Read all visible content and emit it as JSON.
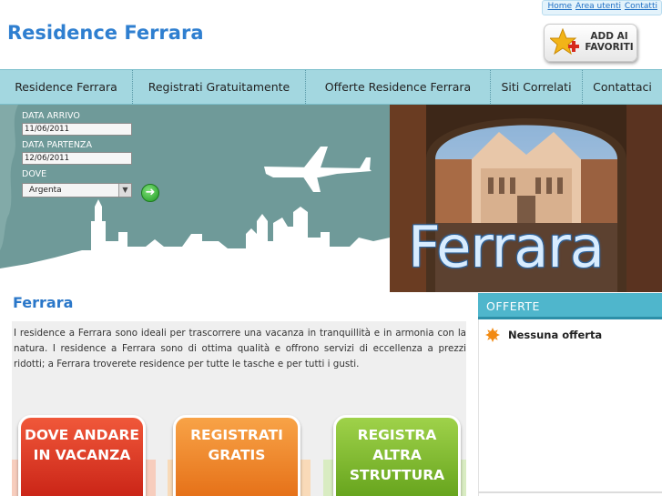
{
  "header": {
    "site_title": "Residence Ferrara",
    "top_links": [
      "Home",
      "Area utenti",
      "Contatti"
    ],
    "favorites_button": "ADD AI FAVORITI"
  },
  "nav": {
    "items": [
      "Residence Ferrara",
      "Registrati Gratuitamente",
      "Offerte Residence Ferrara",
      "Siti Correlati",
      "Contattaci"
    ]
  },
  "search_form": {
    "arrival_label": "DATA ARRIVO",
    "arrival_value": "11/06/2011",
    "departure_label": "DATA PARTENZA",
    "departure_value": "12/06/2011",
    "where_label": "DOVE",
    "where_value": "Argenta"
  },
  "banner": {
    "city_word": "Ferrara"
  },
  "main": {
    "title": "Ferrara",
    "intro": "I residence a Ferrara sono ideali per trascorrere una vacanza in tranquillità e in armonia con la natura. I residence a Ferrara sono di ottima qualità e offrono servizi di eccellenza a prezzi ridotti; a Ferrara troverete residence per tutte le tasche e per tutti i gusti.",
    "cta_buttons": [
      {
        "label": "DOVE ANDARE IN VACANZA",
        "color": "#e2321c"
      },
      {
        "label": "REGISTRATI GRATIS",
        "color": "#ef7d1a"
      },
      {
        "label": "REGISTRA ALTRA STRUTTURA",
        "color": "#78b523"
      }
    ]
  },
  "sidebar": {
    "offers_title": "OFFERTE",
    "offers_empty": "Nessuna offerta"
  },
  "colors": {
    "brand_blue": "#2f7fd0",
    "nav_bg": "#a3d7e0",
    "offers_header": "#4fb6cc"
  }
}
